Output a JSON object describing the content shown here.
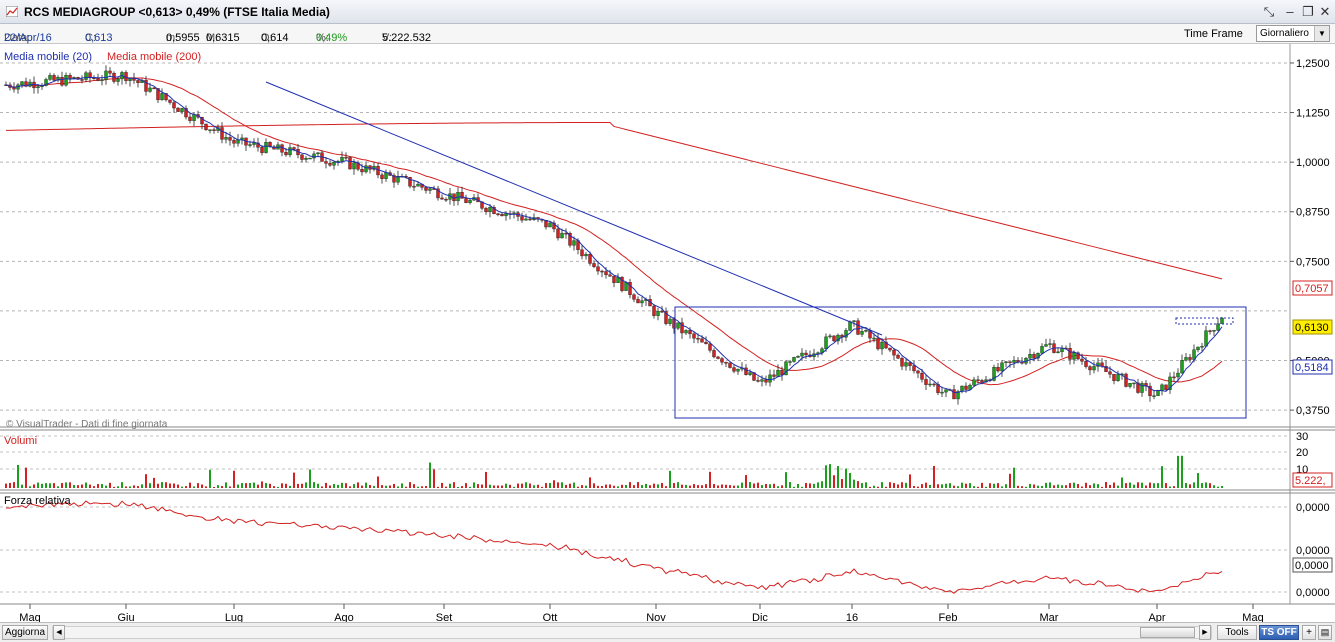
{
  "window": {
    "title": "RCS MEDIAGROUP <0,613> 0,49% (FTSE Italia Media)"
  },
  "infobar": {
    "data_label": "Data:",
    "data_value": "22/Apr/16",
    "c_label": "C:",
    "c_value": "0,613",
    "m_label": "m:",
    "m_value": "0,5955",
    "M_label": "M:",
    "M_value": "0,6315",
    "o_label": "O:",
    "o_value": "0,614",
    "pct_label": "%:",
    "pct_value": "0,49%",
    "v_label": "V:",
    "v_value": "5.222.532",
    "time_frame_label": "Time Frame",
    "time_frame_value": "Giornaliero"
  },
  "price_panel": {
    "legend_ma20": "Media mobile (20)",
    "legend_ma200": "Media mobile (200)",
    "watermark": "© VisualTrader - Dati di fine giornata",
    "y_ticks": [
      "1,2500",
      "1,1250",
      "1,0000",
      "0,8750",
      "0,7500",
      "0,5000",
      "0,3750"
    ],
    "badges": {
      "ma200": "0,7057",
      "last": "0,6130",
      "ma20": "0,5184"
    },
    "colors": {
      "ma200": "#d42020",
      "ma20": "#1f2fb0",
      "up": "#1aa01a",
      "down": "#d42020",
      "last_bg": "#ffee00"
    }
  },
  "volume_panel": {
    "title": "Volumi",
    "y_ticks": [
      "30",
      "20",
      "10"
    ],
    "badge": "5.222,"
  },
  "rs_panel": {
    "title": "Forza relativa",
    "y_ticks": [
      "0,0000",
      "0,0000",
      "0,0000"
    ],
    "badge": "0,0000"
  },
  "x_axis": {
    "labels": [
      "Mag",
      "Giu",
      "Lug",
      "Ago",
      "Set",
      "Ott",
      "Nov",
      "Dic",
      "16",
      "Feb",
      "Mar",
      "Apr",
      "Mag"
    ]
  },
  "bottom_bar": {
    "refresh_label": "Aggiorna",
    "left_arrow": "◀",
    "right_arrow": "▶",
    "plus": "+",
    "tools_label": "Tools",
    "ts_label": "TS OFF"
  },
  "chart_data": {
    "type": "candlestick",
    "title": "RCS MEDIAGROUP",
    "x_labels": [
      "Mag",
      "Giu",
      "Lug",
      "Ago",
      "Set",
      "Ott",
      "Nov",
      "Dic",
      "16",
      "Feb",
      "Mar",
      "Apr",
      "Mag"
    ],
    "ylim": [
      0.34,
      1.26
    ],
    "y_ticks": [
      1.25,
      1.125,
      1.0,
      0.875,
      0.75,
      0.5,
      0.375
    ],
    "series_close_waypoints": [
      {
        "month": "Mag",
        "value": 1.2
      },
      {
        "month": "Giu",
        "value": 1.22
      },
      {
        "month": "Lug",
        "value": 1.05
      },
      {
        "month": "Ago",
        "value": 1.0
      },
      {
        "month": "Set",
        "value": 0.92
      },
      {
        "month": "Ott",
        "value": 0.84
      },
      {
        "month": "Nov",
        "value": 0.62
      },
      {
        "month": "Dic",
        "value": 0.44
      },
      {
        "month": "16",
        "value": 0.59
      },
      {
        "month": "Feb",
        "value": 0.41
      },
      {
        "month": "Mar",
        "value": 0.54
      },
      {
        "month": "Apr",
        "value": 0.41
      },
      {
        "month": "Apr end",
        "value": 0.613
      }
    ],
    "last": {
      "date": "22/Apr/16",
      "open": 0.614,
      "high": 0.6315,
      "low": 0.5955,
      "close": 0.613,
      "change_pct": 0.49,
      "volume": 5222532
    },
    "ma20_last": 0.5184,
    "ma200_last": 0.7057
  }
}
